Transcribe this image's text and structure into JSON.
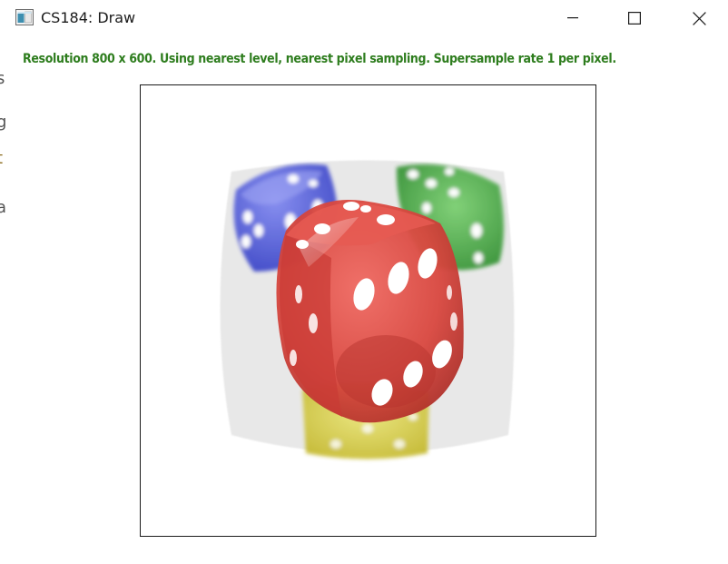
{
  "window": {
    "title": "CS184: Draw",
    "icon": "app-window-icon",
    "controls": [
      "minimize-icon",
      "maximize-icon",
      "close-icon"
    ]
  },
  "status": {
    "text": "Resolution 800 x 600. Using nearest level, nearest pixel sampling. Supersample rate 1 per pixel.",
    "color": "#2e7d1e"
  },
  "canvas": {
    "content": "dice-image",
    "dice_colors": {
      "red": "#d9473f",
      "blue": "#4a55d6",
      "green": "#3aa13a",
      "yellow": "#d8cf3a"
    },
    "backdrop_color": "#e8e8e8"
  }
}
